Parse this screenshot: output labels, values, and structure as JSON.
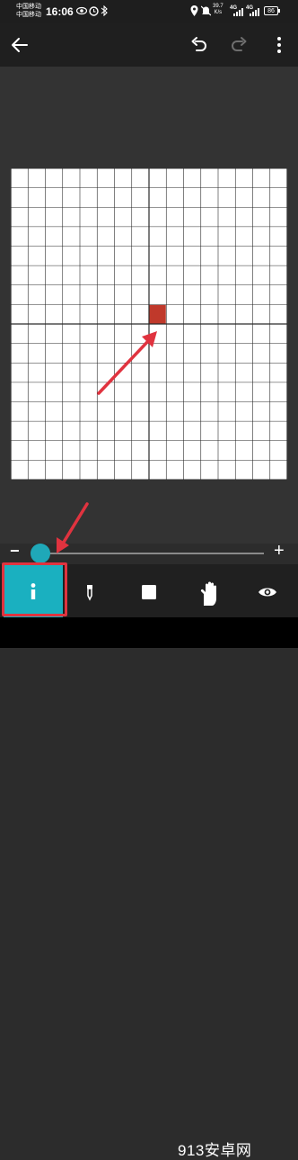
{
  "status_bar": {
    "carrier_1": "中国移动",
    "carrier_2": "中国移动",
    "time": "16:06",
    "net_speed_value": "39.7",
    "net_speed_unit": "K/s",
    "signal_label_1": "4G",
    "signal_label_2": "4G",
    "battery": "86",
    "icons": [
      "eye-icon",
      "alarm-icon",
      "bluetooth-icon",
      "location-icon",
      "mute-icon",
      "signal-icon",
      "battery-icon"
    ]
  },
  "toolbar": {
    "back_icon": "arrow-left-icon",
    "undo_icon": "undo-icon",
    "redo_icon": "redo-icon",
    "menu_icon": "more-vert-icon"
  },
  "canvas": {
    "columns": 16,
    "rows": 16,
    "background": "#ffffff",
    "grid_line_color": "#2a2a2a",
    "filled_pixel": {
      "col": 8,
      "row": 7,
      "color": "#c0392b"
    }
  },
  "slider": {
    "minus_label": "−",
    "plus_label": "+",
    "accent": "#1fa8b8"
  },
  "tools": [
    {
      "name": "info",
      "icon": "info-icon",
      "label": "i",
      "active": true
    },
    {
      "name": "eyedropper",
      "icon": "eyedropper-icon",
      "active": false
    },
    {
      "name": "fill-square",
      "icon": "square-icon",
      "active": false
    },
    {
      "name": "hand",
      "icon": "hand-icon",
      "active": false
    },
    {
      "name": "preview",
      "icon": "eye-icon",
      "active": false
    }
  ],
  "watermark": "913安卓网",
  "annotation_color": "#e0333f"
}
